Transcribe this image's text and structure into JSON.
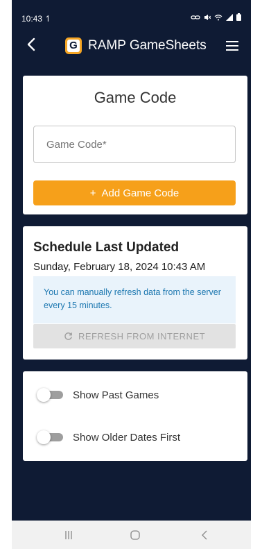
{
  "status_bar": {
    "time": "10:43",
    "time_icon": "signal-indicator-icon",
    "right_icons": "link-icon mute-icon wifi-icon signal-icon battery-icon"
  },
  "app_bar": {
    "title": "RAMP GameSheets",
    "logo_letter": "G"
  },
  "game_code_card": {
    "title": "Game Code",
    "input_placeholder": "Game Code*",
    "input_value": "",
    "add_button_icon": "+",
    "add_button_label": "Add Game Code"
  },
  "schedule_card": {
    "title": "Schedule Last Updated",
    "updated_at": "Sunday, February 18, 2024 10:43 AM",
    "info_text": "You can manually refresh data from the server every 15 minutes.",
    "refresh_button_label": "REFRESH FROM INTERNET"
  },
  "settings_card": {
    "toggles": [
      {
        "label": "Show Past Games",
        "on": false
      },
      {
        "label": "Show Older Dates First",
        "on": false
      }
    ]
  },
  "colors": {
    "background": "#0f1b34",
    "accent": "#f6a01a",
    "info_text": "#1c77b0",
    "info_background": "#e9f3fb"
  }
}
